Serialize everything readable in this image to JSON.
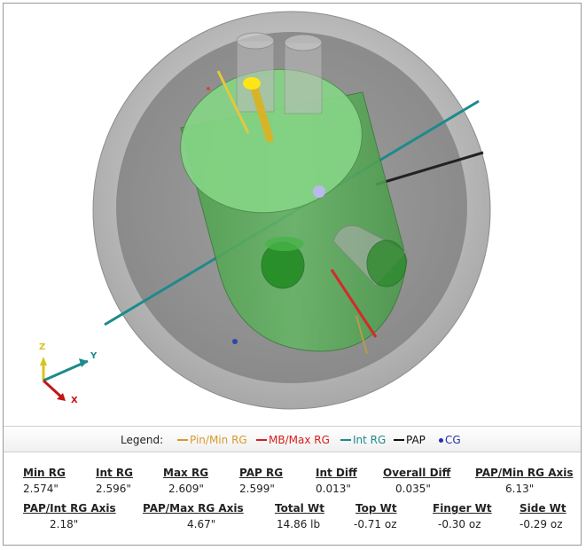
{
  "axes": {
    "x": "X",
    "y": "Y",
    "z": "Z"
  },
  "legend": {
    "title": "Legend:",
    "items": [
      {
        "label": "Pin/Min RG",
        "color": "#d89b2b",
        "marker": "line"
      },
      {
        "label": "MB/Max RG",
        "color": "#d62020",
        "marker": "line"
      },
      {
        "label": "Int RG",
        "color": "#1d8a8c",
        "marker": "line"
      },
      {
        "label": "PAP",
        "color": "#111111",
        "marker": "line"
      },
      {
        "label": "CG",
        "color": "#2233aa",
        "marker": "dot"
      }
    ]
  },
  "stats": {
    "min_rg": {
      "label": "Min RG",
      "value": "2.574\""
    },
    "int_rg": {
      "label": "Int RG",
      "value": "2.596\""
    },
    "max_rg": {
      "label": "Max RG",
      "value": "2.609\""
    },
    "pap_rg": {
      "label": "PAP RG",
      "value": "2.599\""
    },
    "int_diff": {
      "label": "Int Diff",
      "value": "0.013\""
    },
    "overall_diff": {
      "label": "Overall Diff",
      "value": "0.035\""
    },
    "pap_min_axis": {
      "label": "PAP/Min RG Axis",
      "value": "6.13\""
    },
    "pap_int_axis": {
      "label": "PAP/Int RG Axis",
      "value": "2.18\""
    },
    "pap_max_axis": {
      "label": "PAP/Max RG Axis",
      "value": "4.67\""
    },
    "total_wt": {
      "label": "Total Wt",
      "value": "14.86 lb"
    },
    "top_wt": {
      "label": "Top Wt",
      "value": "-0.71 oz"
    },
    "finger_wt": {
      "label": "Finger Wt",
      "value": "-0.30 oz"
    },
    "side_wt": {
      "label": "Side Wt",
      "value": "-0.29 oz"
    }
  }
}
